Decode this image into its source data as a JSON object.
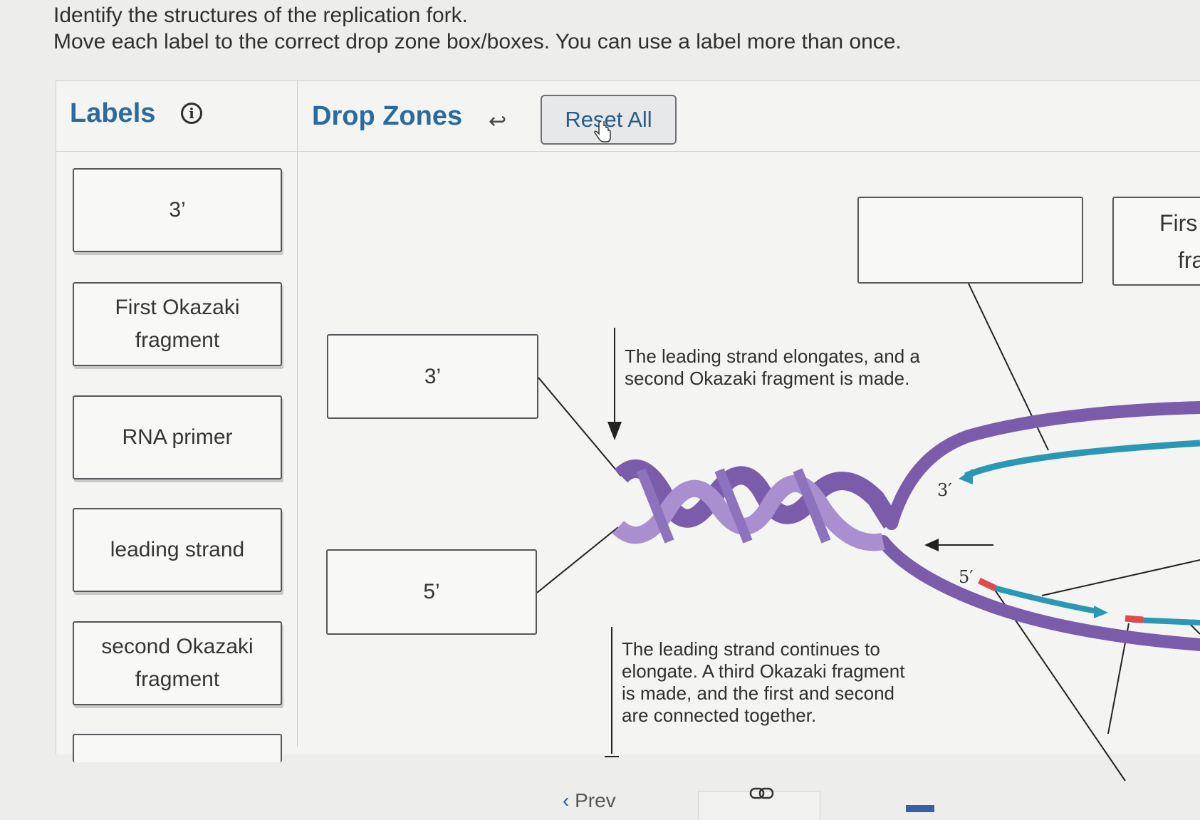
{
  "instructions": {
    "line1": "Identify the structures of the replication fork.",
    "line2": "Move each label to the correct drop zone box/boxes. You can use a label more than once."
  },
  "labels_panel": {
    "heading": "Labels",
    "info_icon": "ⓘ",
    "items": [
      {
        "text": "3’"
      },
      {
        "text": "First Okazaki fragment"
      },
      {
        "text": "RNA primer"
      },
      {
        "text": "leading strand"
      },
      {
        "text": "second Okazaki fragment"
      }
    ]
  },
  "dropzones_panel": {
    "heading": "Drop Zones",
    "undo_icon": "undo-arrow-icon",
    "reset_label": "Reset All"
  },
  "dropzones": {
    "zone_3prime": "3’",
    "zone_5prime": "5’",
    "zone_top_empty": "",
    "zone_first_okazaki_line1": "Firs",
    "zone_first_okazaki_line2": "fra"
  },
  "diagram": {
    "caption_1": "The leading strand elongates, and a second Okazaki fragment is made.",
    "caption_2": "The leading strand continues to elongate. A third Okazaki fragment is made, and the first and second are connected together.",
    "end_label_3": "3′",
    "end_label_5": "5′",
    "colors": {
      "strand_purple": "#7b5cab",
      "strand_light": "#a98fcf",
      "okazaki_teal": "#2a98b4",
      "primer_red": "#e04a4a"
    }
  },
  "pager": {
    "prev_label": "Prev"
  }
}
